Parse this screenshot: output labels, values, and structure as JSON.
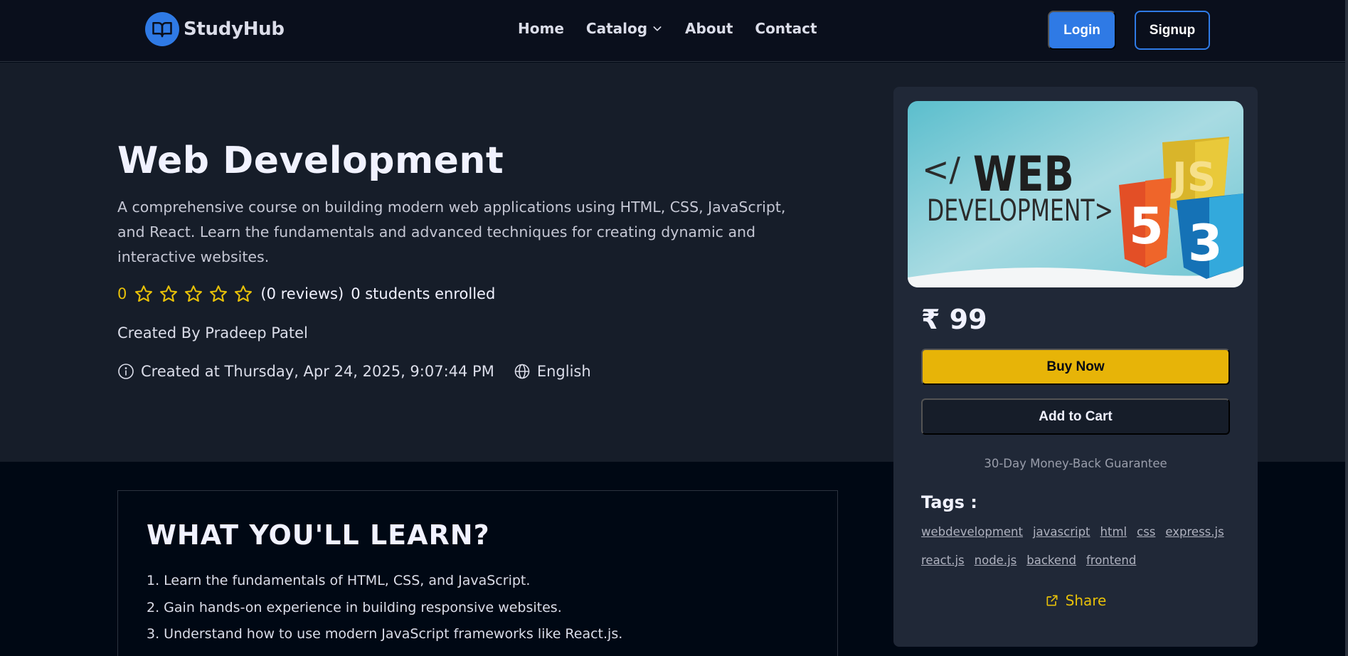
{
  "navbar": {
    "brand": "StudyHub",
    "links": [
      "Home",
      "Catalog",
      "About",
      "Contact"
    ],
    "login_label": "Login",
    "signup_label": "Signup"
  },
  "course": {
    "title": "Web Development",
    "description": "A comprehensive course on building modern web applications using HTML, CSS, JavaScript, and React. Learn the fundamentals and advanced techniques for creating dynamic and interactive websites.",
    "rating": "0",
    "stars_filled": 0,
    "stars_total": 5,
    "reviews": "(0 reviews)",
    "enrolled": "0 students enrolled",
    "created_by": "Created By Pradeep Patel",
    "created_at": "Created at Thursday, Apr 24, 2025, 9:07:44 PM",
    "language": "English"
  },
  "learn": {
    "title": "WHAT YOU'LL LEARN?",
    "items": [
      "1.  Learn the fundamentals of HTML, CSS, and JavaScript.",
      "2.  Gain hands-on experience in building responsive websites.",
      "3.  Understand how to use modern JavaScript frameworks like React.js."
    ]
  },
  "card": {
    "thumbnail_text": {
      "slash": "</",
      "web": "WEB",
      "development": "DEVELOPMENT>",
      "html_badge": "5",
      "js_badge": "JS",
      "css_badge": "3"
    },
    "price": "₹ 99",
    "buy_label": "Buy Now",
    "cart_label": "Add to Cart",
    "guarantee": "30-Day Money-Back Guarantee",
    "tags_title": "Tags :",
    "tags": [
      "webdevelopment",
      "javascript",
      "html",
      "css",
      "express.js",
      "react.js",
      "node.js",
      "backend",
      "frontend"
    ],
    "share_label": "Share"
  },
  "colors": {
    "accent_blue": "#2f7ae5",
    "accent_yellow": "#e7b408",
    "card_bg": "#202837",
    "hero_bg": "#161d29"
  },
  "icons": [
    "book-open-icon",
    "chevron-down-icon",
    "star-icon",
    "info-icon",
    "globe-icon",
    "share-icon"
  ]
}
